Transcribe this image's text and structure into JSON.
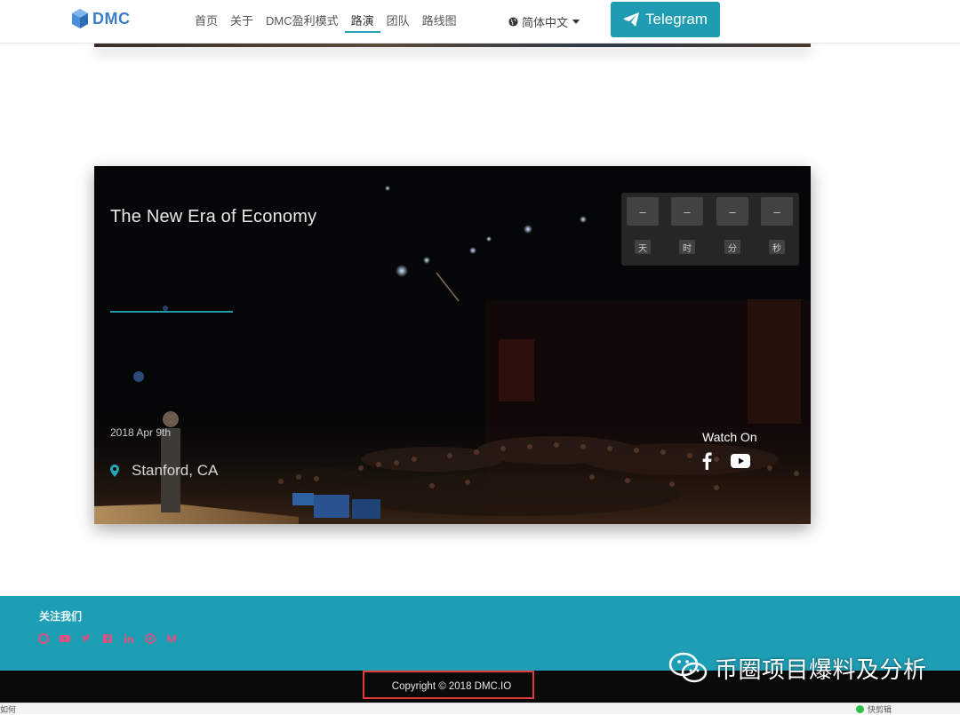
{
  "header": {
    "logo_text": "DMC",
    "nav": [
      "首页",
      "关于",
      "DMC盈利模式",
      "路演",
      "团队",
      "路线图"
    ],
    "active_nav": "路演",
    "language": "简体中文",
    "telegram_label": "Telegram",
    "colors": {
      "accent": "#1f9bb2",
      "logo": "#3d7fc7"
    }
  },
  "event": {
    "title": "The New Era of Economy",
    "date": "2018 Apr 9th",
    "location": "Stanford, CA",
    "countdown": {
      "values": [
        "–",
        "–",
        "–",
        "–"
      ],
      "labels": [
        "天",
        "时",
        "分",
        "秒"
      ]
    },
    "watch_on": "Watch On",
    "icons": [
      "map-pin-icon",
      "facebook-icon",
      "youtube-icon"
    ],
    "accent_line_color": "#1f9aa8"
  },
  "footer": {
    "follow_title": "关注我们",
    "social_icons": [
      "weibo-icon",
      "youtube-icon",
      "twitter-icon",
      "facebook-icon",
      "linkedin-icon",
      "github-icon",
      "medium-icon"
    ],
    "copyright": "Copyright © 2018 DMC.IO",
    "background_color": "#1e9eb5"
  },
  "watermark": {
    "text": "币圈项目爆料及分析"
  },
  "status_bar": {
    "left_text": "如何",
    "right_text": "快剪辑"
  }
}
